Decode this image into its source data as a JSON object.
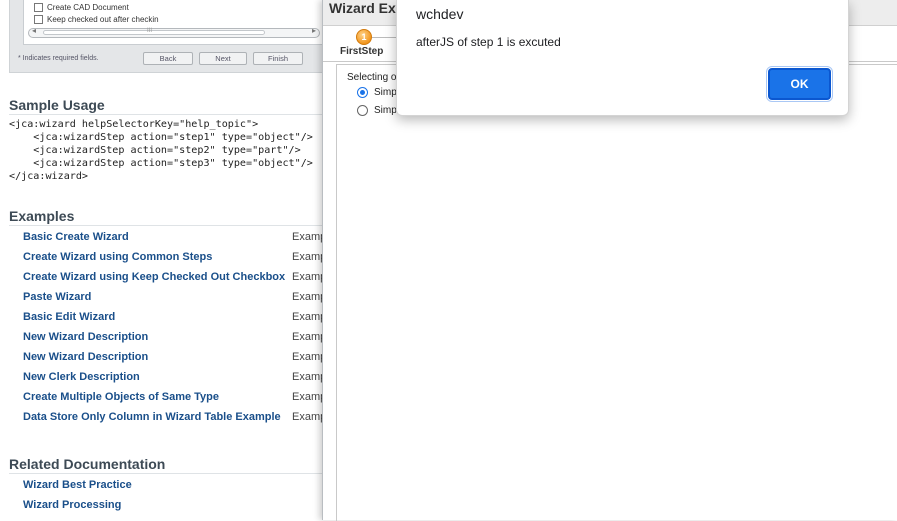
{
  "preview": {
    "checkbox1_label": "Create CAD Document",
    "checkbox2_label": "Keep checked out after checkin",
    "scroll_left": "◂",
    "scroll_grip": "III",
    "scroll_right": "▸",
    "required_note": "* Indicates required fields.",
    "back_label": "Back",
    "next_label": "Next",
    "finish_label": "Finish"
  },
  "sample_usage": {
    "heading": "Sample Usage",
    "code": "<jca:wizard helpSelectorKey=\"help_topic\">\n    <jca:wizardStep action=\"step1\" type=\"object\"/>\n    <jca:wizardStep action=\"step2\" type=\"part\"/>\n    <jca:wizardStep action=\"step3\" type=\"object\"/>\n</jca:wizard>"
  },
  "examples": {
    "heading": "Examples",
    "items": [
      {
        "link": "Basic Create Wizard",
        "desc": "Examp"
      },
      {
        "link": "Create Wizard using Common Steps",
        "desc": "Examp"
      },
      {
        "link": "Create Wizard using Keep Checked Out Checkbox",
        "desc": "Examp"
      },
      {
        "link": "Paste Wizard",
        "desc": "Examp"
      },
      {
        "link": "Basic Edit Wizard",
        "desc": "Examp"
      },
      {
        "link": "New Wizard Description",
        "desc": "Examp"
      },
      {
        "link": "New Wizard Description",
        "desc": "Examp"
      },
      {
        "link": "New Clerk Description",
        "desc": "Examp"
      },
      {
        "link": "Create Multiple Objects of Same Type",
        "desc": "Examp"
      },
      {
        "link": "Data Store Only Column in Wizard Table Example",
        "desc": "Examp"
      }
    ]
  },
  "related": {
    "heading": "Related Documentation",
    "items": [
      {
        "link": "Wizard Best Practice"
      },
      {
        "link": "Wizard Processing"
      }
    ]
  },
  "wizard": {
    "title": "Wizard Exa",
    "step_number": "1",
    "step_label": "FirstStep",
    "selecting_label": "Selecting o",
    "radio1_label": "Simp",
    "radio2_label": "Simp"
  },
  "alert": {
    "origin": "wchdev",
    "message": "afterJS of step 1 is excuted",
    "ok_label": "OK"
  },
  "colors": {
    "link": "#1a4f8a",
    "accent_button": "#1a73e8",
    "step_badge": "#f2961e"
  }
}
